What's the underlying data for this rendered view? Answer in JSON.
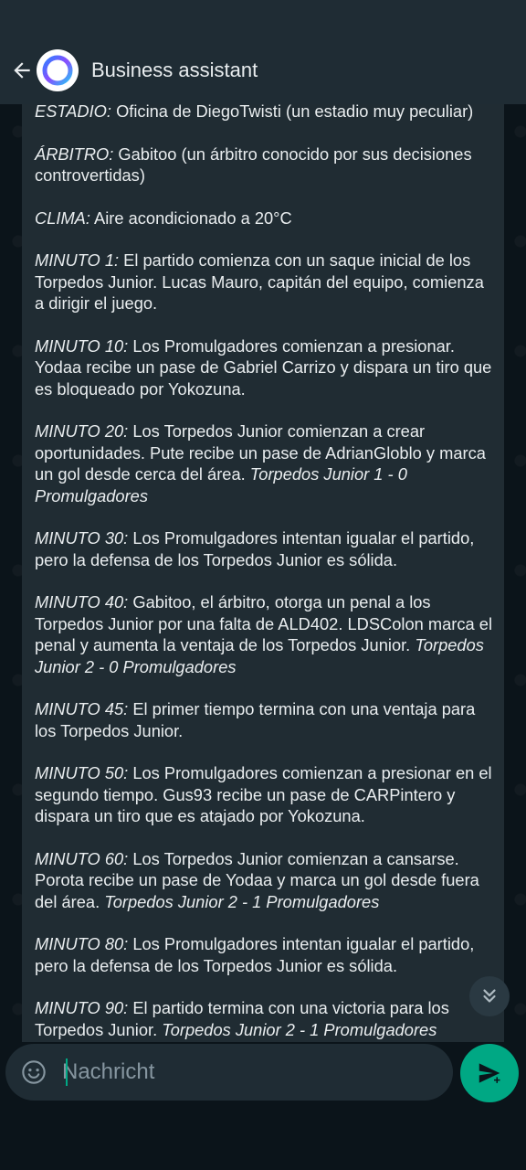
{
  "header": {
    "title": "Business assistant",
    "back_icon": "arrow-left-icon",
    "avatar_icon": "assistant-ring-icon"
  },
  "message": {
    "paragraphs": [
      {
        "label": "ESTADIO:",
        "text": " Oficina de DiegoTwisti (un estadio muy peculiar)",
        "score": ""
      },
      {
        "label": "ÁRBITRO:",
        "text": " Gabitoo (un árbitro conocido por sus decisiones controvertidas)",
        "score": ""
      },
      {
        "label": "CLIMA:",
        "text": " Aire acondicionado a 20°C",
        "score": ""
      },
      {
        "label": "MINUTO 1:",
        "text": " El partido comienza con un saque inicial de los Torpedos Junior. Lucas Mauro, capitán del equipo, comienza a dirigir el juego.",
        "score": ""
      },
      {
        "label": "MINUTO 10:",
        "text": " Los Promulgadores comienzan a presionar. Yodaa recibe un pase de Gabriel Carrizo y dispara un tiro que es bloqueado por Yokozuna.",
        "score": ""
      },
      {
        "label": "MINUTO 20:",
        "text": " Los Torpedos Junior comienzan a crear oportunidades. Pute recibe un pase de AdrianGloblo y marca un gol desde cerca del área. ",
        "score": "Torpedos Junior 1 - 0 Promulgadores"
      },
      {
        "label": "MINUTO 30:",
        "text": " Los Promulgadores intentan igualar el partido, pero la defensa de los Torpedos Junior es sólida.",
        "score": ""
      },
      {
        "label": "MINUTO 40:",
        "text": " Gabitoo, el árbitro, otorga un penal a los Torpedos Junior por una falta de ALD402. LDSColon marca el penal y aumenta la ventaja de los Torpedos Junior. ",
        "score": "Torpedos Junior 2 - 0 Promulgadores"
      },
      {
        "label": "MINUTO 45:",
        "text": " El primer tiempo termina con una ventaja para los Torpedos Junior.",
        "score": ""
      },
      {
        "label": "MINUTO 50:",
        "text": " Los Promulgadores comienzan a presionar en el segundo tiempo. Gus93 recibe un pase de CARPintero y dispara un tiro que es atajado por Yokozuna.",
        "score": ""
      },
      {
        "label": "MINUTO 60:",
        "text": " Los Torpedos Junior comienzan a cansarse. Porota recibe un pase de Yodaa y marca un gol desde fuera del área. ",
        "score": "Torpedos Junior 2 - 1 Promulgadores"
      },
      {
        "label": "MINUTO 80:",
        "text": " Los Promulgadores intentan igualar el partido, pero la defensa de los Torpedos Junior es sólida.",
        "score": ""
      },
      {
        "label": "MINUTO 90:",
        "text": " El partido termina con una victoria para los Torpedos Junior. ",
        "score": "Torpedos Junior 2 - 1 Promulgadores"
      }
    ]
  },
  "scroll_button": {
    "icon": "double-chevron-down-icon"
  },
  "composer": {
    "placeholder": "Nachricht",
    "emoji_icon": "emoji-icon",
    "send_icon": "send-icon"
  },
  "colors": {
    "accent": "#00a884",
    "header_bg": "#1f2c34",
    "bubble_bg": "#202c33",
    "chat_bg": "#0b141a"
  }
}
